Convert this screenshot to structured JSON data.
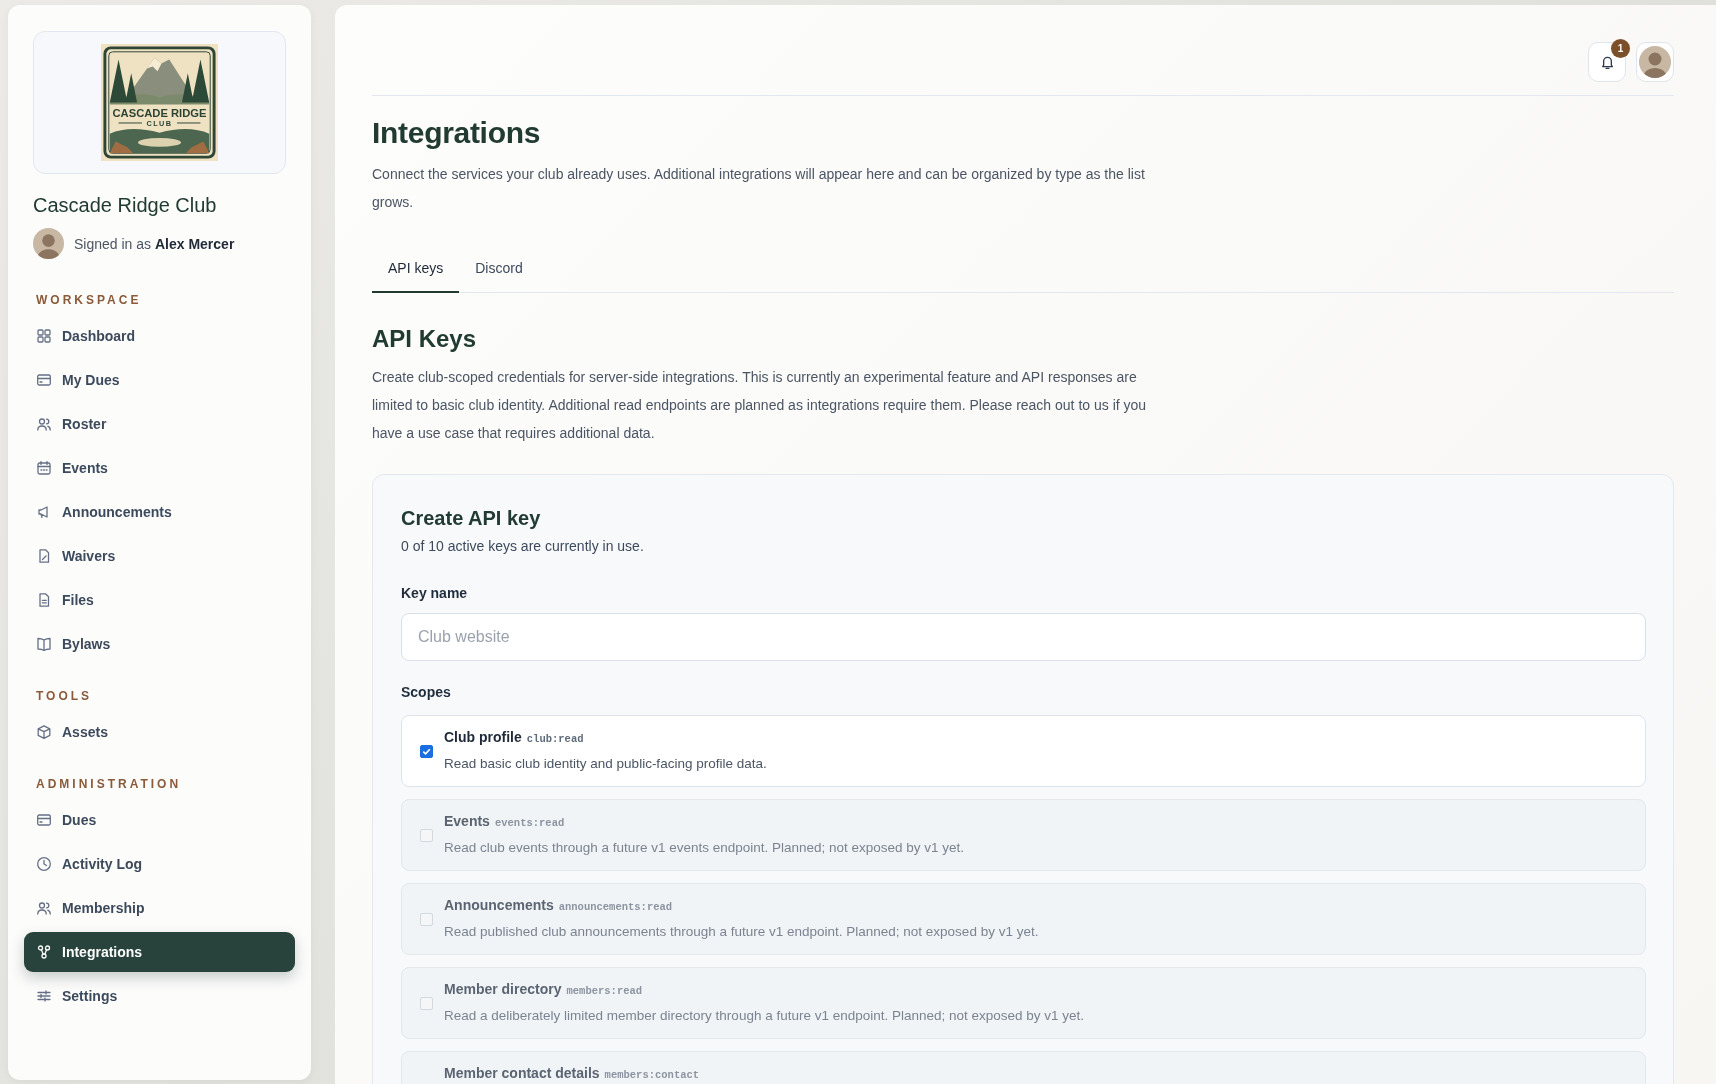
{
  "sidebar": {
    "logo": {
      "wordmark": "CASCADE RIDGE",
      "subtitle": "CLUB"
    },
    "club_name": "Cascade Ridge Club",
    "signed_in": "Signed in as **Alex Mercer**",
    "sections": [
      {
        "heading": "WORKSPACE",
        "items": [
          {
            "label": "Dashboard",
            "selected": false
          },
          {
            "label": "My Dues",
            "selected": false
          },
          {
            "label": "Roster",
            "selected": false
          },
          {
            "label": "Events",
            "selected": false
          },
          {
            "label": "Announcements",
            "selected": false
          },
          {
            "label": "Waivers",
            "selected": false
          },
          {
            "label": "Files",
            "selected": false
          },
          {
            "label": "Bylaws",
            "selected": false
          }
        ]
      },
      {
        "heading": "TOOLS",
        "items": [
          {
            "label": "Assets",
            "selected": false
          }
        ]
      },
      {
        "heading": "ADMINISTRATION",
        "items": [
          {
            "label": "Dues",
            "selected": false
          },
          {
            "label": "Activity Log",
            "selected": false
          },
          {
            "label": "Membership",
            "selected": false
          },
          {
            "label": "Integrations",
            "selected": true
          },
          {
            "label": "Settings",
            "selected": false
          }
        ]
      }
    ]
  },
  "header": {
    "notification_count": "1"
  },
  "page": {
    "title": "Integrations",
    "description": "Connect the services your club already uses. Additional integrations will appear here and can be organized by type as the list grows."
  },
  "tabs": [
    {
      "label": "API keys",
      "selected": true
    },
    {
      "label": "Discord",
      "selected": false
    }
  ],
  "api_keys": {
    "title": "API Keys",
    "description": "Create club-scoped credentials for server-side integrations. This is currently an experimental feature and API responses are limited to basic club identity. Additional read endpoints are planned as integrations require them. Please reach out to us if you have a use case that requires additional data.",
    "create_card": {
      "title": "Create API key",
      "usage": "0 of 10 active keys are currently in use.",
      "key_name": {
        "label": "Key name",
        "placeholder": "Club website"
      },
      "scopes_label": "Scopes",
      "scopes": [
        {
          "title": "Club profile",
          "code": "club:read",
          "description": "Read basic club identity and public-facing profile data.",
          "checked": true,
          "disabled": false
        },
        {
          "title": "Events",
          "code": "events:read",
          "description": "Read club events through a future v1 events endpoint. Planned; not exposed by v1 yet.",
          "checked": false,
          "disabled": true
        },
        {
          "title": "Announcements",
          "code": "announcements:read",
          "description": "Read published club announcements through a future v1 endpoint. Planned; not exposed by v1 yet.",
          "checked": false,
          "disabled": true
        },
        {
          "title": "Member directory",
          "code": "members:read",
          "description": "Read a deliberately limited member directory through a future v1 endpoint. Planned; not exposed by v1 yet.",
          "checked": false,
          "disabled": true
        },
        {
          "title": "Member contact details",
          "code": "members:contact",
          "disabled": true
        }
      ]
    }
  }
}
